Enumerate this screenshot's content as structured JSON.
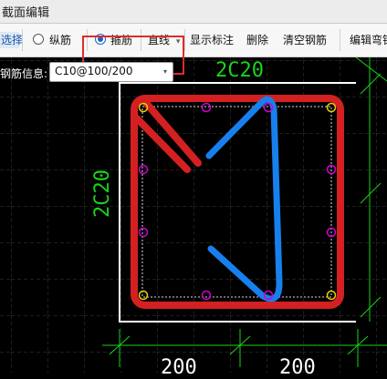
{
  "window": {
    "title": "截面编辑"
  },
  "toolbar": {
    "select_label": "选择",
    "longitudinal_label": "纵筋",
    "stirrup_label": "箍筋",
    "line_type_label": "直线",
    "line_type_arrow": "▾",
    "show_annotation_label": "显示标注",
    "delete_label": "删除",
    "clear_rebar_label": "清空钢筋",
    "edit_hook_label": "编辑弯钩"
  },
  "rebar_info": {
    "label": "钢筋信息:",
    "value": "C10@100/200",
    "arrow": "▾"
  },
  "drawing": {
    "top_rebar_label": "2C20",
    "side_rebar_label": "2C20",
    "dimensions": [
      "200",
      "200"
    ],
    "colors": {
      "stirrup_red": "#d42020",
      "stirrup_blue": "#1780ee",
      "rebar_yellow": "#e6d100",
      "rebar_magenta": "#d000d0",
      "annotation_green": "#19d419"
    }
  }
}
